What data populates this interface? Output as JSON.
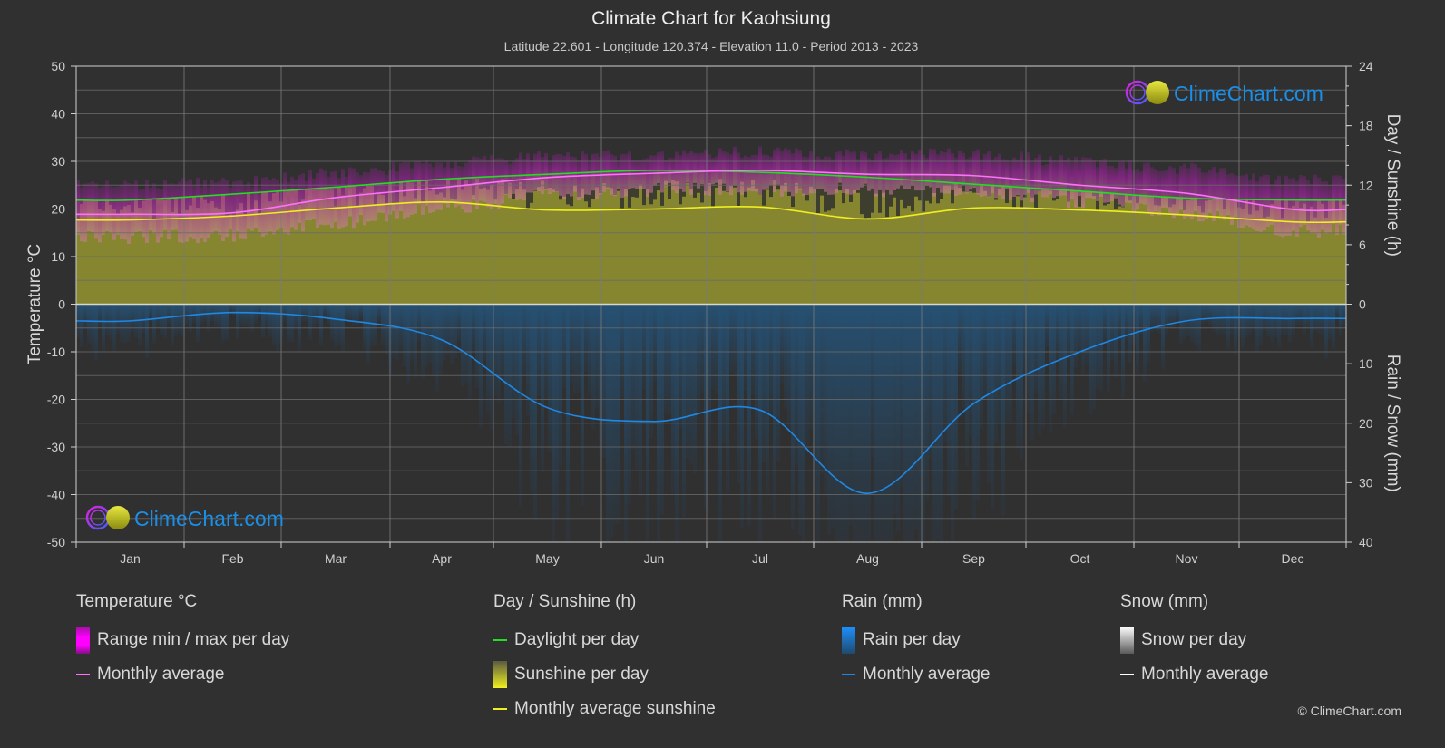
{
  "header": {
    "title": "Climate Chart for Kaohsiung",
    "subtitle": "Latitude 22.601 - Longitude 120.374 - Elevation 11.0 - Period 2013 - 2023"
  },
  "watermark": {
    "text": "ClimeChart.com"
  },
  "copyright": "© ClimeChart.com",
  "colors": {
    "background": "#303030",
    "temp_range": "#c020c0",
    "temp_avg": "#ff70ff",
    "daylight": "#22dd22",
    "sunshine_fill": "#9a9a30",
    "sunshine_avg": "#eeee22",
    "rain": "#1e88e5",
    "snow_avg": "#ffffff",
    "brand": "#1a8fe8"
  },
  "legend": {
    "temperature": {
      "title": "Temperature °C",
      "items": [
        "Range min / max per day",
        "Monthly average"
      ]
    },
    "sunshine": {
      "title": "Day / Sunshine (h)",
      "items": [
        "Daylight per day",
        "Sunshine per day",
        "Monthly average sunshine"
      ]
    },
    "rain": {
      "title": "Rain (mm)",
      "items": [
        "Rain per day",
        "Monthly average"
      ]
    },
    "snow": {
      "title": "Snow (mm)",
      "items": [
        "Snow per day",
        "Monthly average"
      ]
    }
  },
  "chart_data": {
    "type": "line",
    "title": "Climate Chart for Kaohsiung",
    "categories": [
      "Jan",
      "Feb",
      "Mar",
      "Apr",
      "May",
      "Jun",
      "Jul",
      "Aug",
      "Sep",
      "Oct",
      "Nov",
      "Dec"
    ],
    "axes": {
      "left": {
        "label": "Temperature °C",
        "range": [
          -50,
          50
        ],
        "ticks": [
          50,
          40,
          30,
          20,
          10,
          0,
          -10,
          -20,
          -30,
          -40,
          -50
        ]
      },
      "right_top": {
        "label": "Day / Sunshine (h)",
        "range": [
          0,
          24
        ],
        "ticks": [
          24,
          18,
          12,
          6,
          0
        ]
      },
      "right_bottom": {
        "label": "Rain / Snow (mm)",
        "range": [
          0,
          40
        ],
        "ticks": [
          0,
          10,
          20,
          30,
          40
        ]
      }
    },
    "grid": true,
    "series": [
      {
        "name": "Temperature monthly average (°C)",
        "axis": "left",
        "values": [
          18.9,
          19.2,
          22.4,
          24.5,
          26.6,
          27.5,
          28.1,
          27.3,
          27.0,
          25.0,
          23.3,
          19.9
        ]
      },
      {
        "name": "Temperature daily max approx (°C)",
        "axis": "left",
        "values": [
          24.5,
          25.0,
          27.0,
          29.0,
          30.5,
          31.0,
          31.5,
          31.0,
          31.0,
          29.5,
          28.0,
          25.5
        ]
      },
      {
        "name": "Temperature daily min approx (°C)",
        "axis": "left",
        "values": [
          15.5,
          16.0,
          18.5,
          21.5,
          24.0,
          25.5,
          25.5,
          25.5,
          25.0,
          23.0,
          20.5,
          17.0
        ]
      },
      {
        "name": "Daylight per day (h)",
        "axis": "right_top",
        "values": [
          10.5,
          11.1,
          11.8,
          12.6,
          13.1,
          13.5,
          13.3,
          12.8,
          12.1,
          11.4,
          10.7,
          10.5
        ]
      },
      {
        "name": "Monthly average sunshine (h)",
        "axis": "right_top",
        "values": [
          8.5,
          8.9,
          9.7,
          10.3,
          9.5,
          9.6,
          9.8,
          8.6,
          9.7,
          9.5,
          9.0,
          8.3
        ]
      },
      {
        "name": "Rain monthly average (mm)",
        "axis": "right_bottom",
        "values": [
          2.8,
          1.4,
          2.5,
          6.0,
          17.4,
          19.7,
          17.8,
          31.8,
          16.7,
          8.0,
          2.8,
          2.4
        ]
      },
      {
        "name": "Snow monthly average (mm)",
        "axis": "right_bottom",
        "values": [
          0,
          0,
          0,
          0,
          0,
          0,
          0,
          0,
          0,
          0,
          0,
          0
        ]
      }
    ]
  }
}
